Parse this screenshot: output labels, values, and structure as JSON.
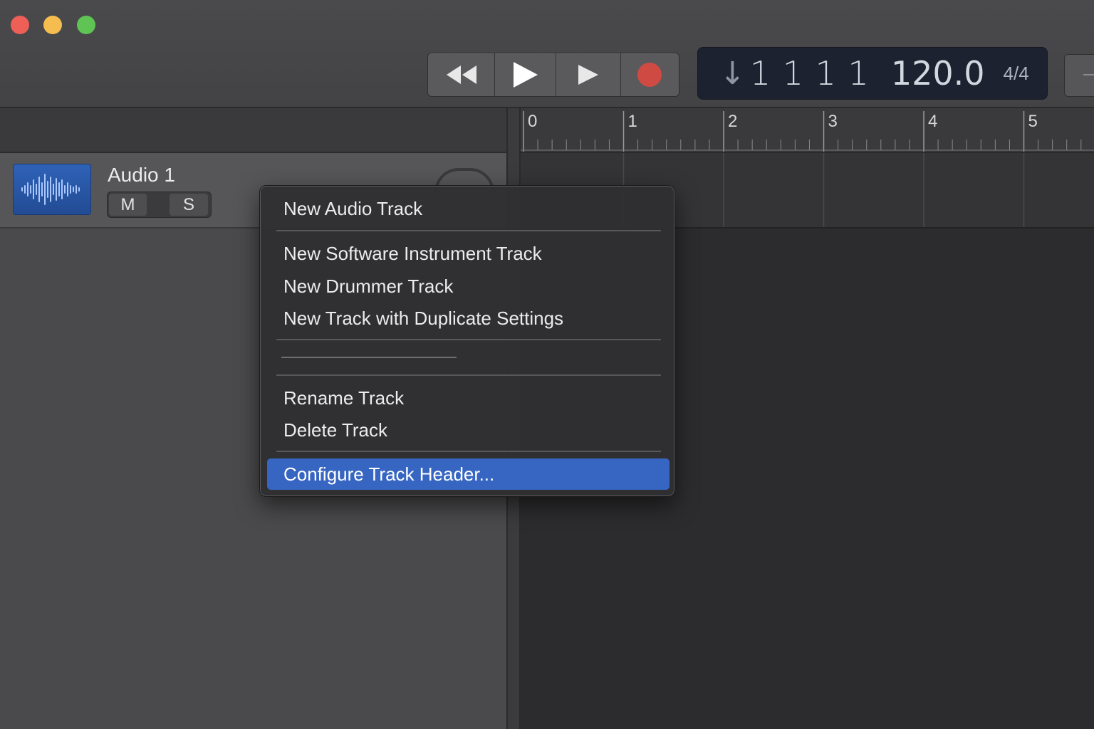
{
  "window": {
    "controls": [
      "close",
      "minimize",
      "maximize"
    ]
  },
  "transport": {
    "buttons": [
      "rewind-icon",
      "play-icon",
      "forward-icon",
      "record-icon"
    ],
    "record_color": "#d04a44"
  },
  "lcd": {
    "position": "1 1 1 1",
    "tempo": "120.0",
    "signature": "4/4"
  },
  "ruler": {
    "bars": [
      "0",
      "1",
      "2",
      "3",
      "4",
      "5"
    ]
  },
  "track": {
    "name": "Audio 1",
    "mute_label": "M",
    "solo_label": "S",
    "icon": "waveform-icon",
    "icon_color": "#2f62b7"
  },
  "context_menu": {
    "items": [
      "New Audio Track",
      "New Software Instrument Track",
      "New Drummer Track",
      "New Track with Duplicate Settings",
      "Rename Track",
      "Delete Track",
      "Configure Track Header..."
    ],
    "highlighted": "Configure Track Header...",
    "highlight_color": "#3766c2"
  }
}
